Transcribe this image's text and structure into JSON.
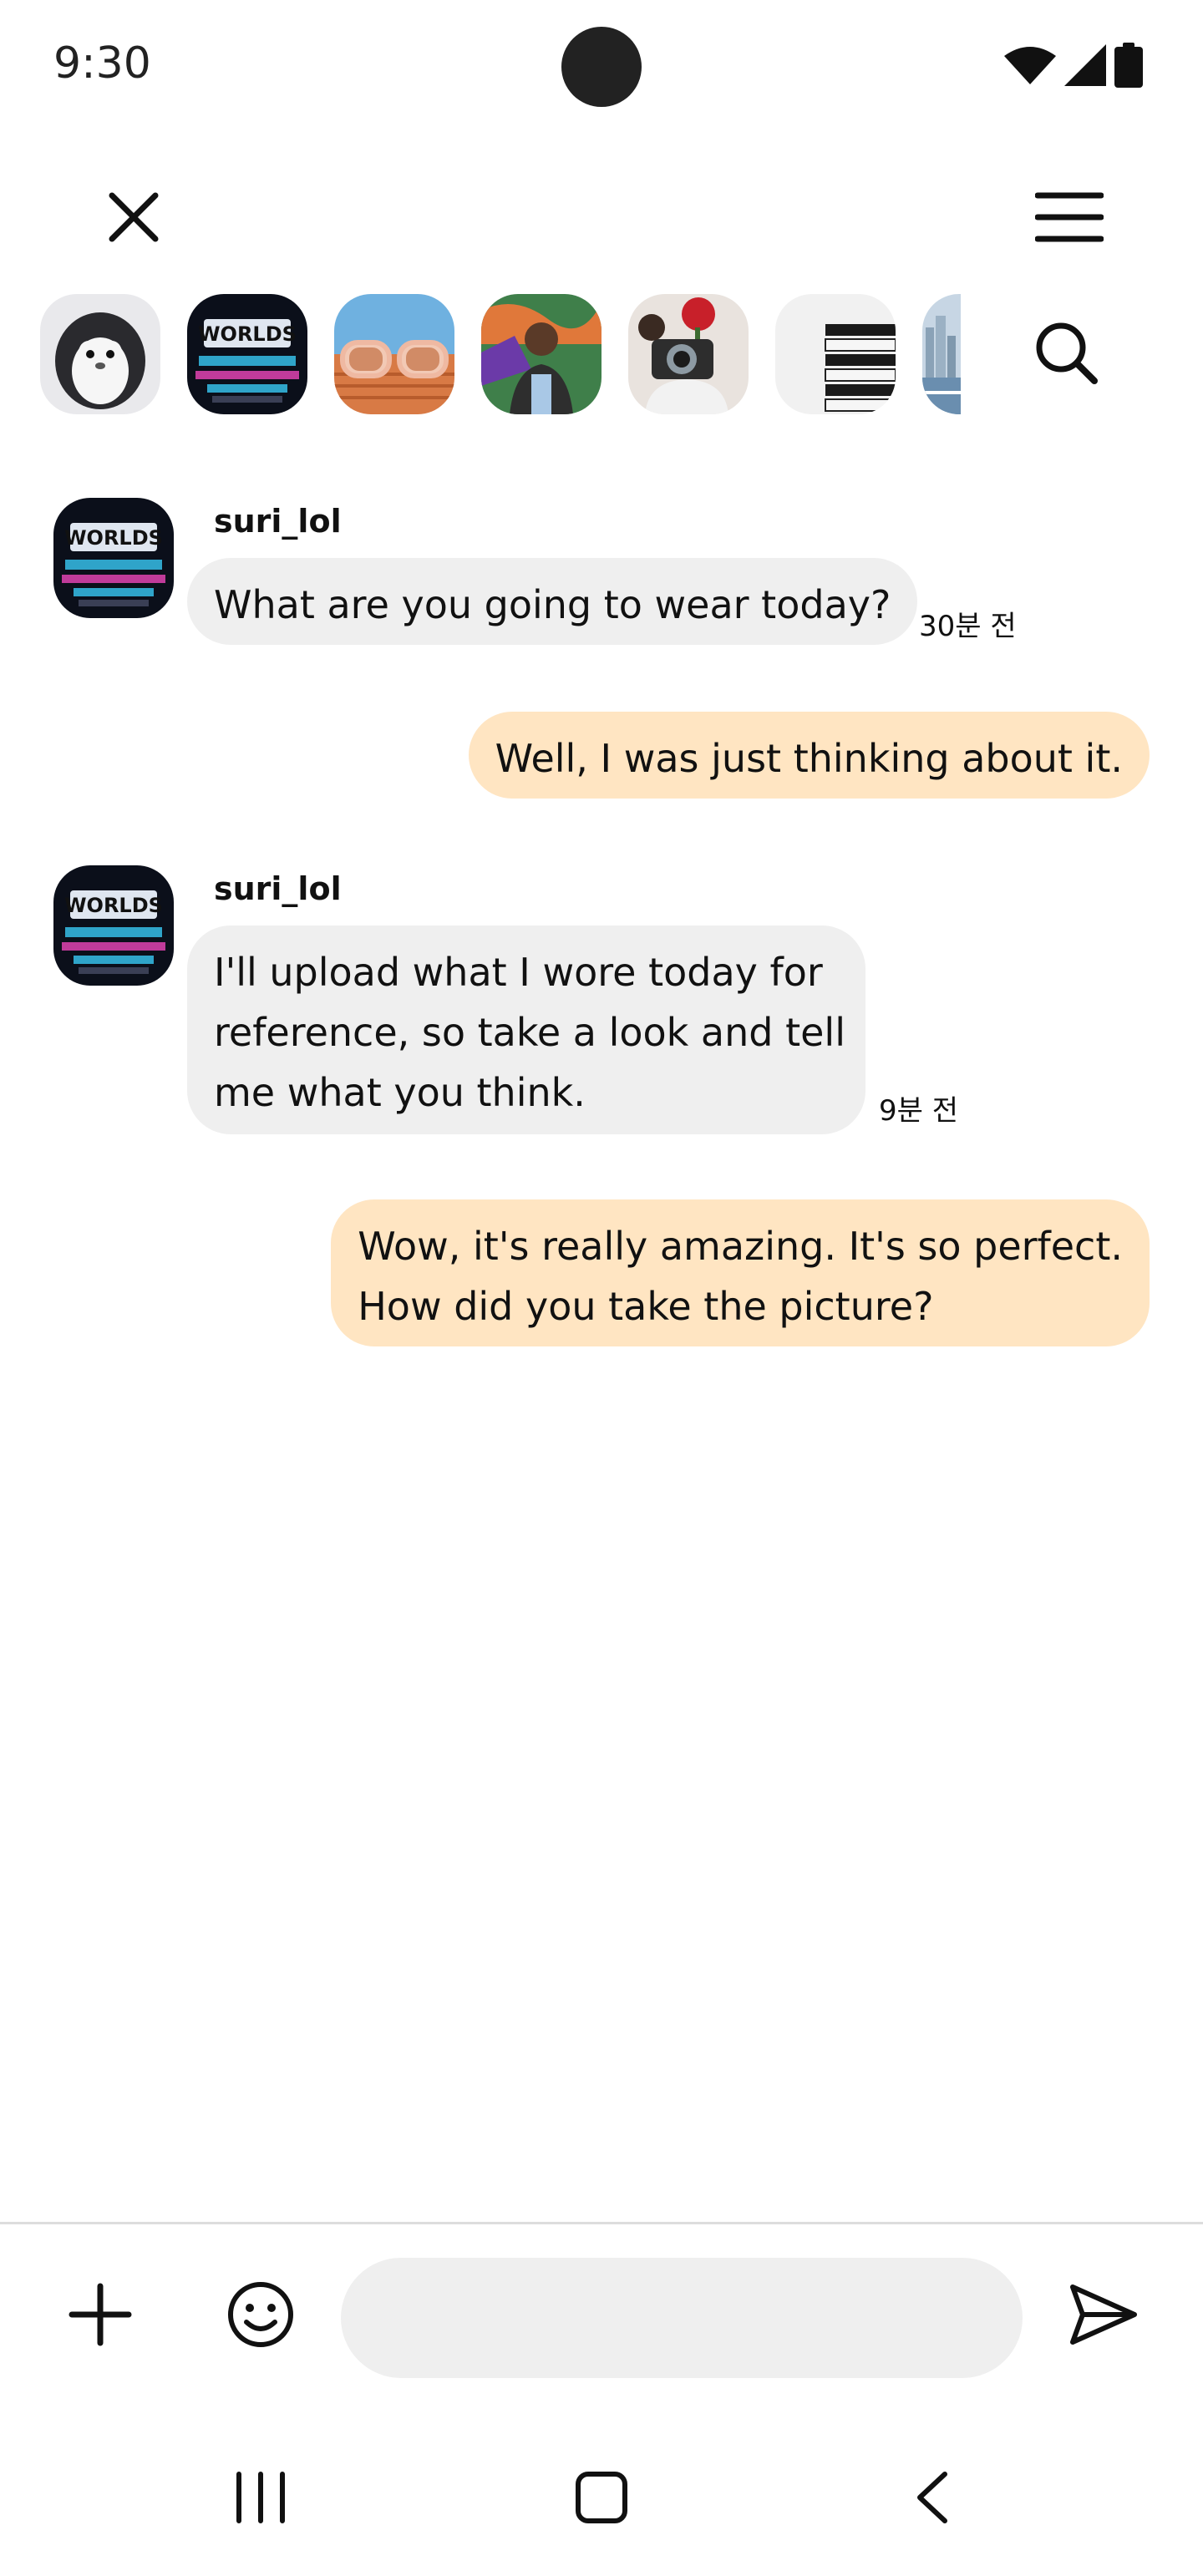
{
  "status": {
    "time": "9:30"
  },
  "header": {
    "close_icon": "close-icon",
    "menu_icon": "hamburger-menu-icon",
    "search_icon": "search-icon"
  },
  "stories": [
    {
      "id": "penguin",
      "icon": "penguin-plush-photo"
    },
    {
      "id": "worlds",
      "icon": "worlds-event-photo"
    },
    {
      "id": "sunglasses",
      "icon": "sunglasses-photo"
    },
    {
      "id": "man-graffiti",
      "icon": "man-graffiti-photo"
    },
    {
      "id": "camera-flower",
      "icon": "camera-flower-photo"
    },
    {
      "id": "vogue-books",
      "icon": "vogue-books-photo"
    },
    {
      "id": "city-harbor",
      "icon": "city-harbor-photo"
    }
  ],
  "messages": [
    {
      "sender": "suri_lol",
      "direction": "in",
      "text": "What are you going to wear today?",
      "time": "30분 전"
    },
    {
      "direction": "out",
      "text": "Well, I was just thinking about it."
    },
    {
      "sender": "suri_lol",
      "direction": "in",
      "lines": [
        "I'll upload what I wore today for",
        "reference, so take a look and tell",
        "me what you think."
      ],
      "time": "9분 전"
    },
    {
      "direction": "out",
      "lines": [
        "Wow, it's really amazing. It's so perfect.",
        "How did you take the picture?"
      ]
    }
  ],
  "composer": {
    "placeholder": "",
    "value": ""
  },
  "colors": {
    "incoming_bubble": "#efefef",
    "outgoing_bubble": "#ffe5c2",
    "text": "#111111"
  }
}
